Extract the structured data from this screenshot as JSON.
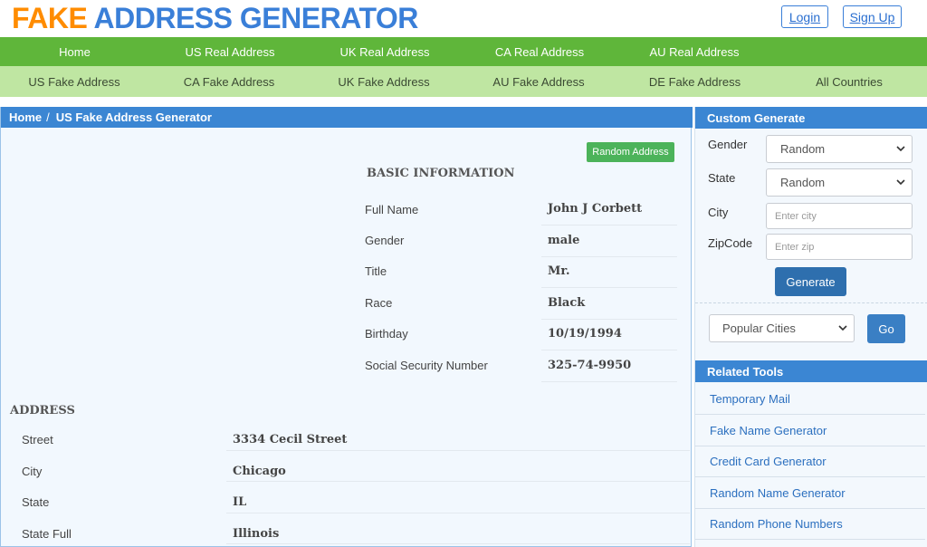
{
  "header": {
    "logo_part1": "FAKE",
    "logo_part2": "ADDRESS GENERATOR",
    "login_label": "Login",
    "signup_label": "Sign Up"
  },
  "nav_primary": [
    "Home",
    "US Real Address",
    "UK Real Address",
    "CA Real Address",
    "AU Real Address"
  ],
  "nav_secondary": [
    "US Fake Address",
    "CA Fake Address",
    "UK Fake Address",
    "AU Fake Address",
    "DE Fake Address",
    "All Countries"
  ],
  "breadcrumb": {
    "home": "Home",
    "separator": "/",
    "current": "US Fake Address Generator"
  },
  "random_address_label": "Random Address",
  "basic_info": {
    "title": "BASIC INFORMATION",
    "rows": [
      {
        "label": "Full Name",
        "value": "John J Corbett"
      },
      {
        "label": "Gender",
        "value": "male"
      },
      {
        "label": "Title",
        "value": "Mr."
      },
      {
        "label": "Race",
        "value": "Black"
      },
      {
        "label": "Birthday",
        "value": "10/19/1994"
      },
      {
        "label": "Social Security Number",
        "value": "325-74-9950"
      }
    ]
  },
  "address": {
    "title": "ADDRESS",
    "rows": [
      {
        "label": "Street",
        "value": "3334  Cecil Street"
      },
      {
        "label": "City",
        "value": "Chicago"
      },
      {
        "label": "State",
        "value": "IL"
      },
      {
        "label": "State Full",
        "value": "Illinois"
      }
    ]
  },
  "custom_generate": {
    "title": "Custom Generate",
    "gender_label": "Gender",
    "gender_value": "Random",
    "state_label": "State",
    "state_value": "Random",
    "city_label": "City",
    "city_placeholder": "Enter city",
    "zip_label": "ZipCode",
    "zip_placeholder": "Enter zip",
    "generate_label": "Generate",
    "popular_cities_value": "Popular Cities",
    "go_label": "Go"
  },
  "related_tools": {
    "title": "Related Tools",
    "items": [
      "Temporary Mail",
      "Fake Name Generator",
      "Credit Card Generator",
      "Random Name Generator",
      "Random Phone Numbers"
    ]
  },
  "colors": {
    "logo_orange": "#ff8c00",
    "logo_blue": "#3a7fd8",
    "nav_primary_bg": "#5fb63a",
    "nav_secondary_bg": "#bfe6a2",
    "panel_header_bg": "#3b86d3",
    "random_button_bg": "#4cb35a",
    "generate_button_bg": "#2e6fae",
    "link_color": "#2b6fbf"
  }
}
